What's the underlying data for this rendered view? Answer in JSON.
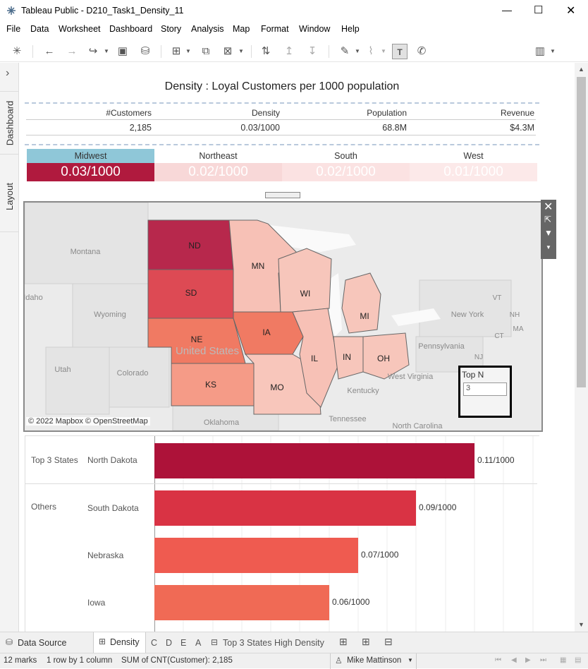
{
  "window": {
    "title": "Tableau Public - D210_Task1_Density_11",
    "minimize": "—",
    "maximize": "☐",
    "close": "✕",
    "icon": "tableau-logo-icon"
  },
  "menu": [
    "File",
    "Data",
    "Worksheet",
    "Dashboard",
    "Story",
    "Analysis",
    "Map",
    "Format",
    "Window",
    "Help"
  ],
  "left_rail": {
    "expand": "›",
    "tabs": [
      "Dashboard",
      "Layout"
    ]
  },
  "dashboard": {
    "title": "Density :  Loyal Customers per 1000 population",
    "kpis": {
      "headers": [
        "#Customers",
        "Density",
        "Population",
        "Revenue"
      ],
      "values": [
        "2,185",
        "0.03/1000",
        "68.8M",
        "$4.3M"
      ]
    },
    "regions": {
      "headers": [
        "Midwest",
        "Northeast",
        "South",
        "West"
      ],
      "values": [
        "0.03/1000",
        "0.02/1000",
        "0.02/1000",
        "0.01/1000"
      ],
      "colors": [
        "#b01a3e",
        "#f8d8d8",
        "#fbe2e2",
        "#fce9e9"
      ],
      "header_selected_color": "#8fc7d8"
    },
    "map": {
      "state_abbrevs": [
        "ND",
        "SD",
        "NE",
        "KS",
        "MN",
        "IA",
        "MO",
        "WI",
        "IL",
        "MI",
        "IN",
        "OH"
      ],
      "base_labels": [
        "Montana",
        "Wyoming",
        "Idaho",
        "Utah",
        "Colorado",
        "United States",
        "Oklahoma",
        "New York",
        "Pennsylvania",
        "West Virginia",
        "Kentucky",
        "Tennessee",
        "North Carolina",
        "VT",
        "NH",
        "CT",
        "NJ",
        "MA"
      ],
      "copyright": "© 2022 Mapbox © OpenStreetMap",
      "top_n_label": "Top N",
      "top_n_value": "3"
    },
    "bars": {
      "groups": [
        "Top 3 States",
        "Others"
      ],
      "items": [
        {
          "state": "North Dakota",
          "value": 0.11,
          "label": "0.11/1000",
          "color": "#ad1239"
        },
        {
          "state": "South Dakota",
          "value": 0.09,
          "label": "0.09/1000",
          "color": "#d93344"
        },
        {
          "state": "Nebraska",
          "value": 0.07,
          "label": "0.07/1000",
          "color": "#ef5b50"
        },
        {
          "state": "Iowa",
          "value": 0.06,
          "label": "0.06/1000",
          "color": "#f06a55"
        }
      ]
    }
  },
  "tabs": {
    "data_source": "Data Source",
    "active": "Density",
    "others": [
      "C",
      "D",
      "E",
      "A"
    ],
    "story": "Top 3 States High Density"
  },
  "status": {
    "marks": "12 marks",
    "layout": "1 row by 1 column",
    "sum": "SUM of CNT(Customer): 2,185",
    "user": "Mike Mattinson"
  }
}
